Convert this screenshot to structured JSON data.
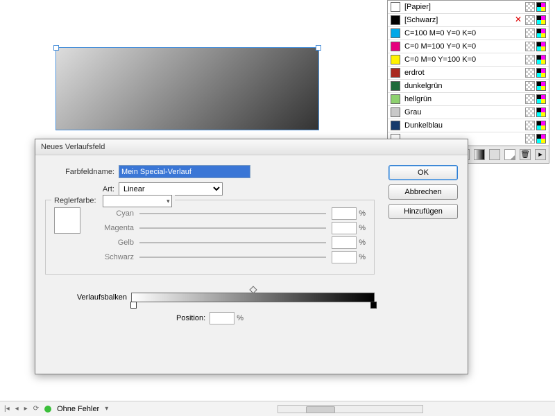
{
  "swatches": [
    {
      "name": "[Papier]",
      "color": "#ffffff",
      "border": "#888",
      "no_edit": false
    },
    {
      "name": "[Schwarz]",
      "color": "#000000",
      "no_edit": true
    },
    {
      "name": "C=100 M=0 Y=0 K=0",
      "color": "#00a8e8"
    },
    {
      "name": "C=0 M=100 Y=0 K=0",
      "color": "#e6007e"
    },
    {
      "name": "C=0 M=0 Y=100 K=0",
      "color": "#fff200"
    },
    {
      "name": "erdrot",
      "color": "#a92a1f"
    },
    {
      "name": "dunkelgrün",
      "color": "#1f6b3a"
    },
    {
      "name": "hellgrün",
      "color": "#8ed16f"
    },
    {
      "name": "Grau",
      "color": "#c8c8c8"
    },
    {
      "name": "Dunkelblau",
      "color": "#163a6b"
    },
    {
      "name": "",
      "color": "#ffffff"
    }
  ],
  "dialog": {
    "title": "Neues Verlaufsfeld",
    "labels": {
      "name": "Farbfeldname:",
      "type": "Art:",
      "stopcolor": "Reglerfarbe:",
      "cyan": "Cyan",
      "magenta": "Magenta",
      "yellow": "Gelb",
      "black": "Schwarz",
      "gradbar": "Verlaufsbalken",
      "position": "Position:"
    },
    "name_value": "Mein Special-Verlauf",
    "type_value": "Linear",
    "pct": "%",
    "buttons": {
      "ok": "OK",
      "cancel": "Abbrechen",
      "add": "Hinzufügen"
    }
  },
  "status": {
    "no_errors": "Ohne Fehler"
  }
}
